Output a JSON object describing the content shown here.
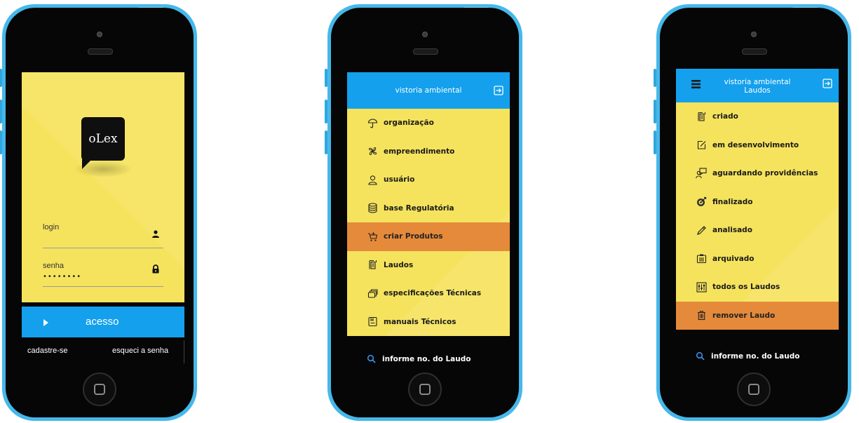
{
  "login_screen": {
    "logo_text": "oLex",
    "login_label": "login",
    "password_label": "senha",
    "password_value": "••••••••",
    "access_button": "acesso",
    "signup_link": "cadastre-se",
    "forgot_link": "esqueci a senha",
    "icons": {
      "user": "user-icon",
      "lock": "lock-icon",
      "play": "play-icon"
    }
  },
  "main_menu": {
    "header_title": "vistoria ambiental",
    "items": [
      {
        "label": "organização",
        "icon": "umbrella-icon",
        "active": false
      },
      {
        "label": "empreendimento",
        "icon": "fan-icon",
        "active": false
      },
      {
        "label": "usuário",
        "icon": "person-icon",
        "active": false
      },
      {
        "label": "base Regulatória",
        "icon": "database-icon",
        "active": false
      },
      {
        "label": "criar Produtos",
        "icon": "cart-icon",
        "active": true
      },
      {
        "label": "Laudos",
        "icon": "report-icon",
        "active": false
      },
      {
        "label": "especificações Técnicas",
        "icon": "layers-icon",
        "active": false
      },
      {
        "label": "manuais Técnicos",
        "icon": "manual-icon",
        "active": false
      }
    ],
    "search_text": "informe no. do Laudo"
  },
  "laudos_menu": {
    "header_title": "vistoria ambiental",
    "header_subtitle": "Laudos",
    "items": [
      {
        "label": "criado",
        "icon": "report-icon",
        "active": false
      },
      {
        "label": "em desenvolvimento",
        "icon": "edit-icon",
        "active": false
      },
      {
        "label": "aguardando providências",
        "icon": "presenter-icon",
        "active": false
      },
      {
        "label": "finalizado",
        "icon": "target-icon",
        "active": false
      },
      {
        "label": "analisado",
        "icon": "pen-icon",
        "active": false
      },
      {
        "label": "arquivado",
        "icon": "clipboard-icon",
        "active": false
      },
      {
        "label": "todos os Laudos",
        "icon": "sliders-icon",
        "active": false
      },
      {
        "label": "remover Laudo",
        "icon": "trash-icon",
        "active": true
      }
    ],
    "search_text": "informe no. do Laudo"
  },
  "colors": {
    "yellow": "#f5e35d",
    "blue": "#14a0ec",
    "orange": "#e58a3a",
    "phone_shell": "#46b8ea"
  }
}
